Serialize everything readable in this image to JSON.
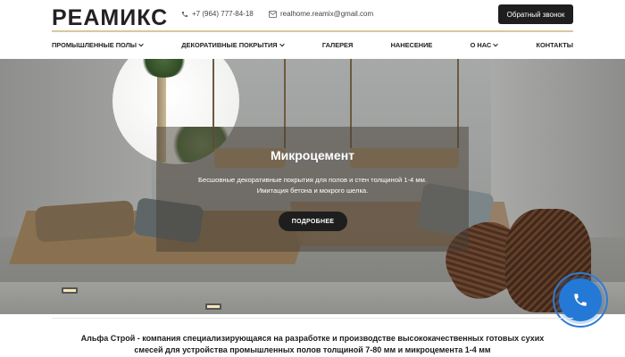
{
  "header": {
    "logo": "РЕАМИКС",
    "phone": "+7 (964) 777-84-18",
    "email": "realhome.reamix@gmail.com",
    "callback_label": "Обратный звонок"
  },
  "nav": {
    "items": [
      {
        "label": "ПРОМЫШЛЕННЫЕ ПОЛЫ",
        "dropdown": true
      },
      {
        "label": "ДЕКОРАТИВНЫЕ ПОКРЫТИЯ",
        "dropdown": true
      },
      {
        "label": "ГАЛЕРЕЯ",
        "dropdown": false
      },
      {
        "label": "НАНЕСЕНИЕ",
        "dropdown": false
      },
      {
        "label": "О НАС",
        "dropdown": true
      },
      {
        "label": "КОНТАКТЫ",
        "dropdown": false
      }
    ]
  },
  "hero": {
    "title": "Микроцемент",
    "subtitle_line1": "Бесшовные декоративные покрытия для полов и стен толщиной 1-4 мм.",
    "subtitle_line2": "Имитация бетона и мокрого шелка.",
    "button_label": "ПОДРОБНЕЕ"
  },
  "intro": {
    "line1": "Альфа Строй - компания специализирующаяся на разработке и производстве высококачественных готовых сухих",
    "line2": "смесей для устройства промышленных полов толщиной 7-80 мм и микроцемента 1-4 мм"
  },
  "icons": {
    "phone": "phone-icon",
    "email": "mail-icon",
    "chevron": "chevron-down-icon",
    "fab": "phone-handset-icon"
  },
  "colors": {
    "accent_line": "#d9c79e",
    "button_dark": "#1e1e1e",
    "fab_blue": "#2479d6"
  }
}
